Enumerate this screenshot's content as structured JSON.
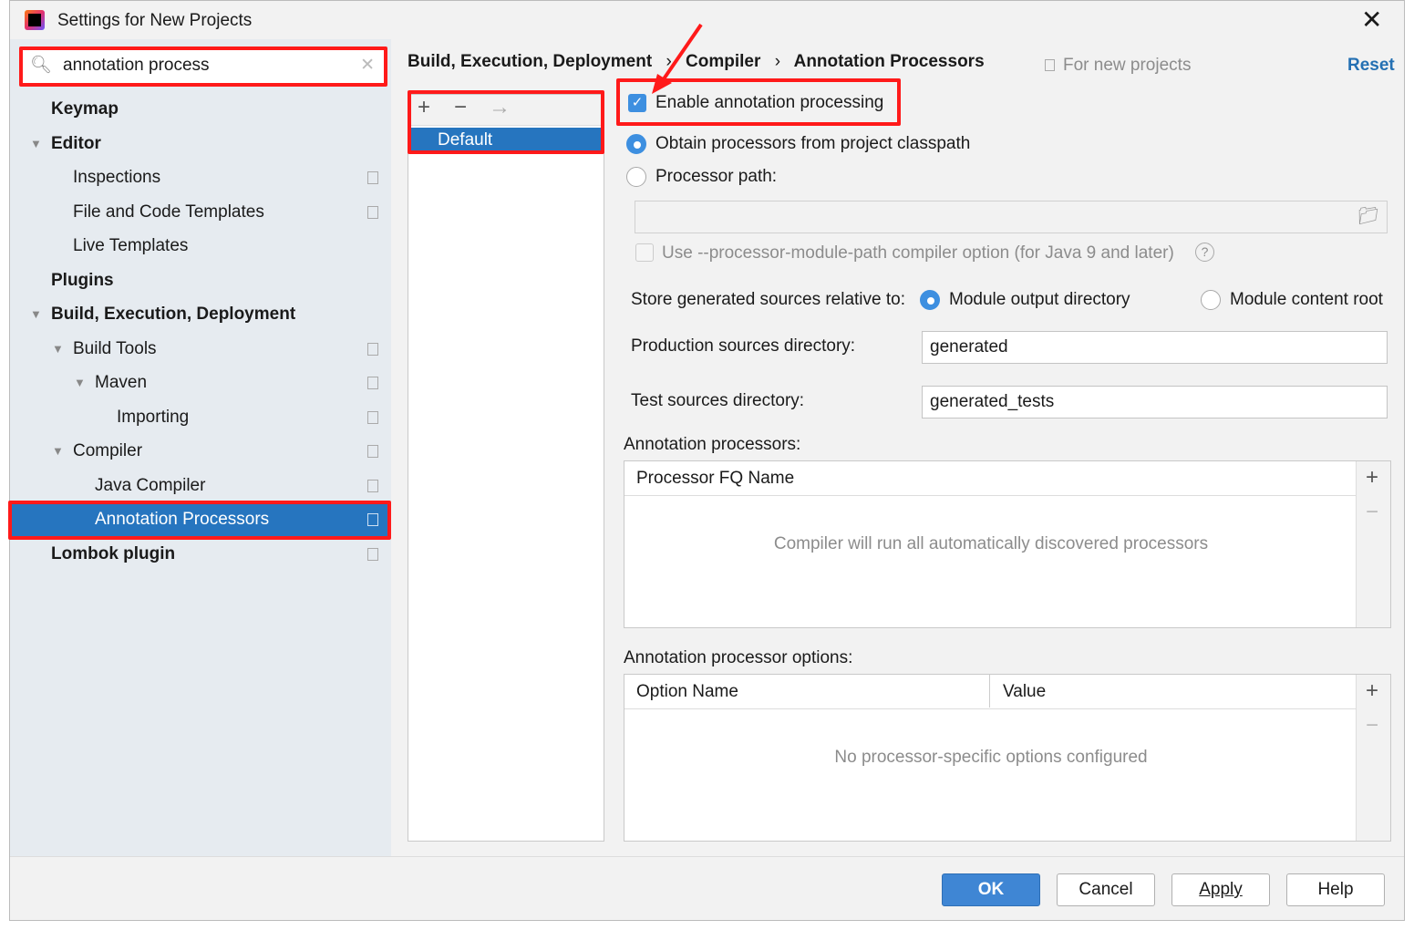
{
  "window": {
    "title": "Settings for New Projects"
  },
  "search": {
    "value": "annotation process"
  },
  "sidebar": {
    "items": [
      {
        "label": "Keymap"
      },
      {
        "label": "Editor"
      },
      {
        "label": "Inspections"
      },
      {
        "label": "File and Code Templates"
      },
      {
        "label": "Live Templates"
      },
      {
        "label": "Plugins"
      },
      {
        "label": "Build, Execution, Deployment"
      },
      {
        "label": "Build Tools"
      },
      {
        "label": "Maven"
      },
      {
        "label": "Importing"
      },
      {
        "label": "Compiler"
      },
      {
        "label": "Java Compiler"
      },
      {
        "label": "Annotation Processors"
      },
      {
        "label": "Lombok plugin"
      }
    ]
  },
  "breadcrumb": {
    "items": [
      "Build, Execution, Deployment",
      "Compiler",
      "Annotation Processors"
    ],
    "scope": "For new projects",
    "reset": "Reset"
  },
  "profiles": {
    "items": [
      "Default"
    ]
  },
  "form": {
    "enable": "Enable annotation processing",
    "enable_checked": true,
    "obtain": "Obtain processors from project classpath",
    "processor_path": "Processor path:",
    "processor_path_value": "",
    "module_path": "Use --processor-module-path compiler option (for Java 9 and later)",
    "store_label": "Store generated sources relative to:",
    "store_opt1": "Module output directory",
    "store_opt2": "Module content root",
    "prod_label": "Production sources directory:",
    "prod_value": "generated",
    "test_label": "Test sources directory:",
    "test_value": "generated_tests"
  },
  "processors": {
    "label": "Annotation processors:",
    "column": "Processor FQ Name",
    "empty": "Compiler will run all automatically discovered processors"
  },
  "options": {
    "label": "Annotation processor options:",
    "columns": [
      "Option Name",
      "Value"
    ],
    "empty": "No processor-specific options configured"
  },
  "buttons": {
    "ok": "OK",
    "cancel": "Cancel",
    "apply": "Apply",
    "help": "Help"
  },
  "colors": {
    "accent": "#2675bf",
    "highlight": "#ff1a1a"
  }
}
